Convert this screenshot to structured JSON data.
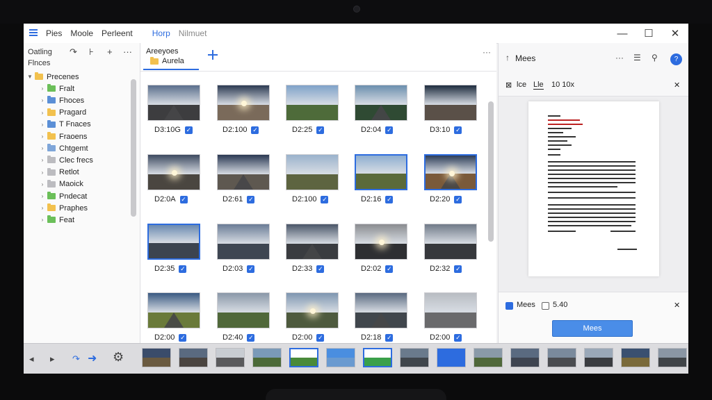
{
  "titlebar": {
    "app_name": "Pies",
    "menus": [
      "Moole",
      "Perleent"
    ],
    "tab_active": "Horp",
    "tab_other": "Nilmuet",
    "minimize": "—",
    "maximize": "☐",
    "close": "✕"
  },
  "left_panel": {
    "label_top": "Oatling",
    "label_bottom": "Flnces",
    "btn_refresh": "↷",
    "btn_split": "⊦",
    "btn_add": "+",
    "btn_more": "···",
    "tree": [
      {
        "label": "Precenes",
        "color": "#f2c14e",
        "chevron": "▼"
      },
      {
        "label": "Fralt",
        "color": "#6bbf59",
        "chevron": "›"
      },
      {
        "label": "Fhoces",
        "color": "#5b8fd6",
        "chevron": "›"
      },
      {
        "label": "Pragard",
        "color": "#f2c14e",
        "chevron": "›"
      },
      {
        "label": "T Fnaces",
        "color": "#5b8fd6",
        "chevron": "›"
      },
      {
        "label": "Fraoens",
        "color": "#f2c14e",
        "chevron": "›"
      },
      {
        "label": "Chtgemt",
        "color": "#7fa6d9",
        "chevron": "›"
      },
      {
        "label": "Clec frecs",
        "color": "#bcbcc0",
        "chevron": "›"
      },
      {
        "label": "Retlot",
        "color": "#bcbcc0",
        "chevron": "›"
      },
      {
        "label": "Maoick",
        "color": "#bcbcc0",
        "chevron": "›"
      },
      {
        "label": "Pndecat",
        "color": "#6bbf59",
        "chevron": "›"
      },
      {
        "label": "Praphes",
        "color": "#f2c14e",
        "chevron": "›"
      },
      {
        "label": "Feat",
        "color": "#6bbf59",
        "chevron": "›"
      }
    ]
  },
  "grid": {
    "tab_title": "Areeyoes",
    "tab_folder": "Aurela",
    "more": "···",
    "items": [
      {
        "caption": "D3:10G",
        "sky": "#5a6e8c",
        "ground": "#3d3d3f",
        "sel": false
      },
      {
        "caption": "D2:100",
        "sky": "#2c3a52",
        "ground": "#7a6a5a",
        "sel": false
      },
      {
        "caption": "D2:25",
        "sky": "#7fa2c8",
        "ground": "#4e6b3a",
        "sel": false
      },
      {
        "caption": "D2:04",
        "sky": "#6b8fae",
        "ground": "#2f4a33",
        "sel": false
      },
      {
        "caption": "D3:10",
        "sky": "#1e2c3e",
        "ground": "#5a5048",
        "sel": false
      },
      {
        "caption": "D2:0A",
        "sky": "#3d4a60",
        "ground": "#4a4640",
        "sel": false
      },
      {
        "caption": "D2:61",
        "sky": "#2a3852",
        "ground": "#5e5850",
        "sel": false
      },
      {
        "caption": "D2:100",
        "sky": "#9ab2cc",
        "ground": "#5d6440",
        "sel": false
      },
      {
        "caption": "D2:16",
        "sky": "#8eaed0",
        "ground": "#5b6a3a",
        "sel": true
      },
      {
        "caption": "D2:20",
        "sky": "#2e3e58",
        "ground": "#7a5a3a",
        "sel": true
      },
      {
        "caption": "D2:35",
        "sky": "#6a8ab0",
        "ground": "#3c4450",
        "sel": true
      },
      {
        "caption": "D2:03",
        "sky": "#6a7c96",
        "ground": "#3e4652",
        "sel": false
      },
      {
        "caption": "D2:33",
        "sky": "#4a5668",
        "ground": "#3a3c40",
        "sel": false
      },
      {
        "caption": "D2:02",
        "sky": "#8a8c90",
        "ground": "#2e2f32",
        "sel": false
      },
      {
        "caption": "D2:32",
        "sky": "#707a88",
        "ground": "#36383c",
        "sel": false
      },
      {
        "caption": "D2:00",
        "sky": "#3a5a82",
        "ground": "#6a7a3a",
        "sel": false
      },
      {
        "caption": "D2:40",
        "sky": "#8a98a8",
        "ground": "#50683a",
        "sel": false
      },
      {
        "caption": "D2:00",
        "sky": "#7e96b0",
        "ground": "#4e5a3e",
        "sel": false
      },
      {
        "caption": "D2:18",
        "sky": "#5a6a80",
        "ground": "#40464c",
        "sel": false
      },
      {
        "caption": "D2:00",
        "sky": "#b8bcc2",
        "ground": "#6a6a6c",
        "sel": false
      }
    ]
  },
  "right_panel": {
    "title": "Mees",
    "btn_more": "···",
    "btn_list": "☰",
    "btn_search": "⚲",
    "btn_help": "?",
    "sub_icon": "⊠",
    "sub_a": "lce",
    "sub_b": "Lle",
    "sub_c": "10 10x",
    "sub_close": "✕",
    "foot_label_a": "Mees",
    "foot_label_b": "5.40",
    "foot_close": "✕",
    "apply_label": "Mees"
  },
  "filmstrip": {
    "ctl_a": "◂",
    "ctl_b": "▸",
    "ctl_c": "↷",
    "ctl_d": "➜",
    "ctl_e": "⚙",
    "items": [
      {
        "sky": "#3a4c6a",
        "ground": "#6a5a40"
      },
      {
        "sky": "#5a6a80",
        "ground": "#4a4440"
      },
      {
        "sky": "#c8ccd2",
        "ground": "#5a5a5c"
      },
      {
        "sky": "#7a9ab8",
        "ground": "#4c6a38"
      },
      {
        "sky": "#ffffff",
        "ground": "#4a8a3a"
      },
      {
        "sky": "#4a8ee0",
        "ground": "#6a9ad0"
      },
      {
        "sky": "#ffffff",
        "ground": "#3aa04a"
      },
      {
        "sky": "#6a7a8c",
        "ground": "#40464c"
      },
      {
        "sky": "#2d6cdf",
        "ground": "#2d6cdf"
      },
      {
        "sky": "#8a9aa8",
        "ground": "#50683a"
      },
      {
        "sky": "#5a6a80",
        "ground": "#3e4450"
      },
      {
        "sky": "#7a8a9c",
        "ground": "#4a4c50"
      },
      {
        "sky": "#9aa8b8",
        "ground": "#3a3c40"
      },
      {
        "sky": "#3a5070",
        "ground": "#7a6a3a"
      },
      {
        "sky": "#8a96a4",
        "ground": "#404448"
      }
    ]
  }
}
